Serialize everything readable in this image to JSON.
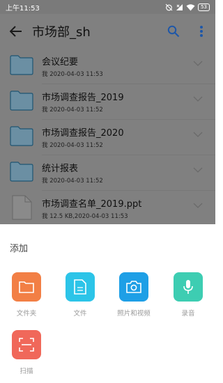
{
  "status": {
    "time": "上午11:53",
    "battery": "53"
  },
  "header": {
    "title": "市场部_sh"
  },
  "files": [
    {
      "name": "会议纪要",
      "meta": "我 2020-04-03 11:53",
      "type": "folder"
    },
    {
      "name": "市场调查报告_2019",
      "meta": "我 2020-04-03 11:52",
      "type": "folder"
    },
    {
      "name": "市场调查报告_2020",
      "meta": "我 2020-04-03 11:52",
      "type": "folder"
    },
    {
      "name": "统计报表",
      "meta": "我 2020-04-03 11:52",
      "type": "folder"
    },
    {
      "name": "市场调查名单_2019.ppt",
      "meta": "我 12.5 KB,2020-04-03 11:53",
      "type": "file"
    }
  ],
  "sheet": {
    "title": "添加",
    "options": [
      {
        "label": "文件夹",
        "color": "#F27F45"
      },
      {
        "label": "文件",
        "color": "#2CC4E8"
      },
      {
        "label": "照片和视频",
        "color": "#1E9FE6"
      },
      {
        "label": "录音",
        "color": "#3DCDB2"
      },
      {
        "label": "扫描",
        "color": "#F0685A"
      }
    ]
  }
}
